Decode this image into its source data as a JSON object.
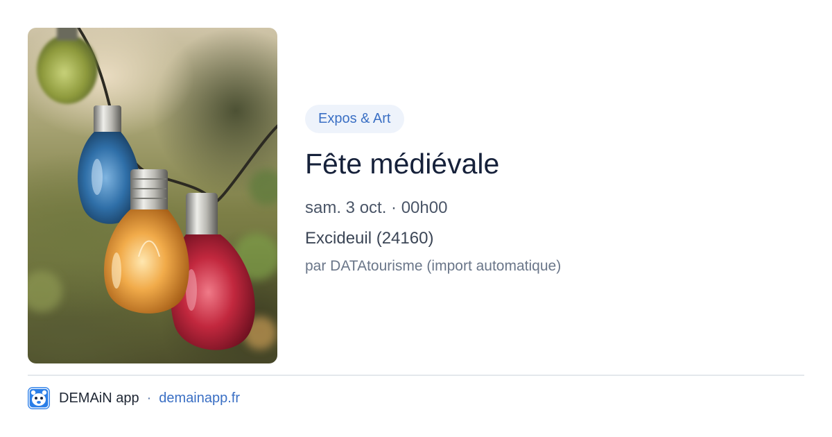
{
  "event": {
    "category": "Expos & Art",
    "title": "Fête médiévale",
    "datetime": "sam. 3 oct. · 00h00",
    "location": "Excideuil (24160)",
    "source": "par DATAtourisme (import automatique)",
    "image": "string-light-bulbs-photo"
  },
  "footer": {
    "app_name": "DEMAiN app",
    "separator": "·",
    "link": "demainapp.fr",
    "app_icon": "demain-mascot-icon"
  },
  "colors": {
    "accent": "#3a6fc4",
    "chip_background": "#eef3fb",
    "title": "#16213a",
    "app_icon_blue": "#2a7ee8"
  }
}
